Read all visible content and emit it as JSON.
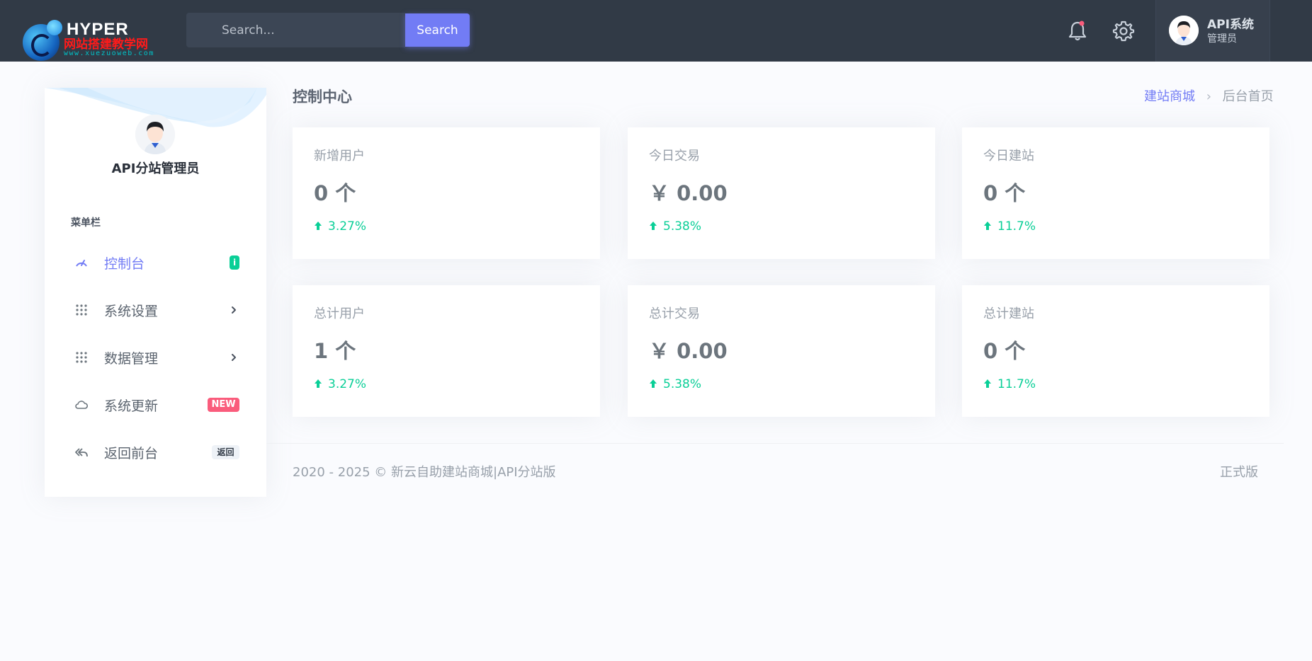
{
  "brand": {
    "title": "HYPER",
    "subtitle": "网站搭建教学网",
    "url": "www.xuezuoweb.com"
  },
  "search": {
    "placeholder": "Search...",
    "button_label": "Search"
  },
  "header_icons": [
    "bell-icon",
    "gear-icon"
  ],
  "user": {
    "name": "API系统",
    "role": "管理员"
  },
  "sidebar": {
    "profile_name": "API分站管理员",
    "menu_title": "菜单栏",
    "items": [
      {
        "label": "控制台",
        "icon": "dashboard-icon",
        "badge": "i",
        "active": true
      },
      {
        "label": "系统设置",
        "icon": "grid-icon",
        "chevron": true
      },
      {
        "label": "数据管理",
        "icon": "grid-icon",
        "chevron": true
      },
      {
        "label": "系统更新",
        "icon": "cloud-icon",
        "badge": "NEW"
      },
      {
        "label": "返回前台",
        "icon": "reply-all-icon",
        "badge": "返回"
      }
    ]
  },
  "page": {
    "title": "控制中心",
    "breadcrumb": [
      "建站商城",
      "后台首页"
    ]
  },
  "cards": [
    {
      "title": "新增用户",
      "value": "0 个",
      "trend": "3.27%"
    },
    {
      "title": "今日交易",
      "value": "￥ 0.00",
      "trend": "5.38%"
    },
    {
      "title": "今日建站",
      "value": "0 个",
      "trend": "11.7%"
    },
    {
      "title": "总计用户",
      "value": "1 个",
      "trend": "3.27%"
    },
    {
      "title": "总计交易",
      "value": "￥ 0.00",
      "trend": "5.38%"
    },
    {
      "title": "总计建站",
      "value": "0 个",
      "trend": "11.7%"
    }
  ],
  "footer": {
    "copyright": "2020 - 2025 © 新云自助建站商城|API分站版",
    "version": "正式版"
  },
  "colors": {
    "topbar": "#313a46",
    "primary": "#727cf5",
    "success": "#0acf97",
    "danger": "#fa5c7c"
  }
}
